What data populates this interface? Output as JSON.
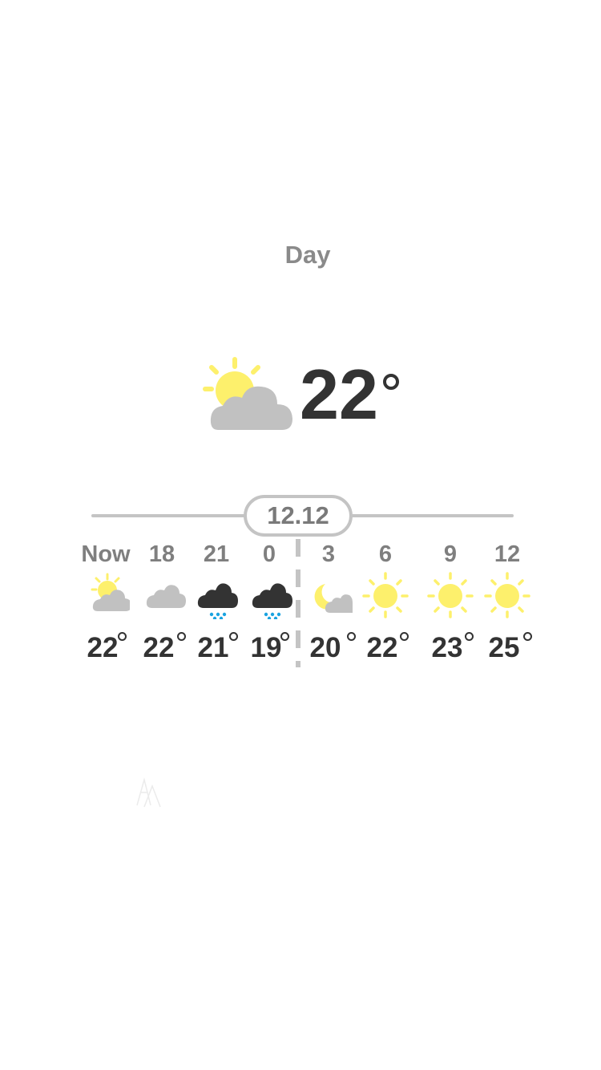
{
  "period": {
    "label": "Day"
  },
  "current": {
    "temperature": "22",
    "condition_icon": "partly-sunny-cloud-icon"
  },
  "timeline": {
    "date": "12.12"
  },
  "forecast": [
    {
      "time": "Now",
      "temp": "22",
      "icon": "partly-sunny-cloud-icon"
    },
    {
      "time": "18",
      "temp": "22",
      "icon": "cloud-icon"
    },
    {
      "time": "21",
      "temp": "21",
      "icon": "snow-cloud-icon"
    },
    {
      "time": "0",
      "temp": "19",
      "icon": "snow-cloud-icon"
    },
    {
      "time": "3",
      "temp": "20",
      "icon": "moon-cloud-icon"
    },
    {
      "time": "6",
      "temp": "22",
      "icon": "sun-icon"
    },
    {
      "time": "9",
      "temp": "23",
      "icon": "sun-icon"
    },
    {
      "time": "12",
      "temp": "25",
      "icon": "sun-icon"
    }
  ],
  "colors": {
    "sun": "#fdf06c",
    "cloud": "#c1c1c1",
    "dark_cloud": "#333333",
    "snow": "#1aa3e0",
    "text_dark": "#333333",
    "text_muted": "#8a8a8a",
    "line": "#c4c4c4"
  }
}
